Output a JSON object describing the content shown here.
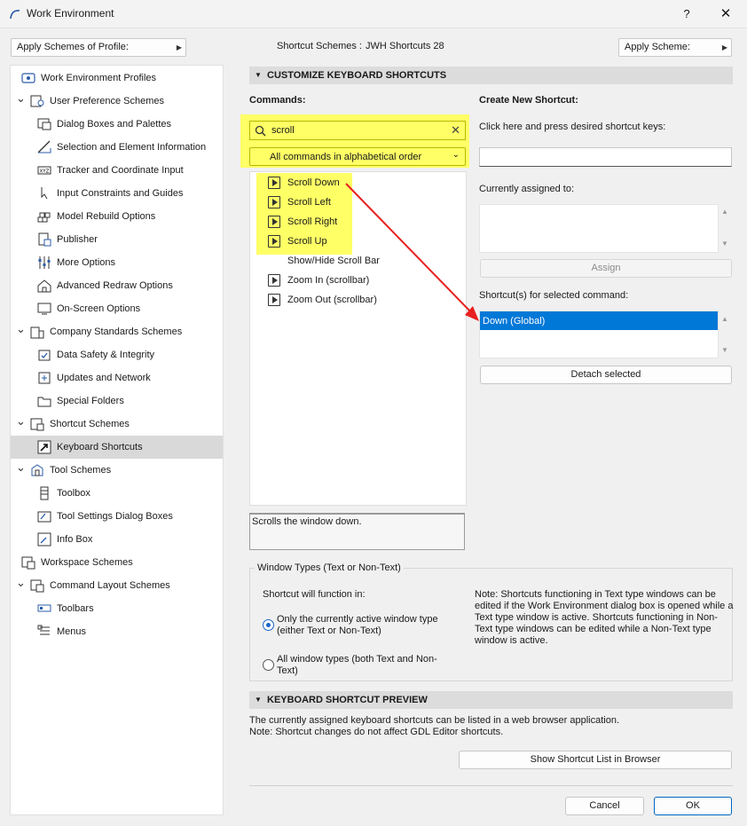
{
  "window": {
    "title": "Work Environment",
    "help": "?",
    "close": "✕"
  },
  "top_bar": {
    "apply_profile_label": "Apply Schemes of Profile:",
    "shortcut_schemes_label": "Shortcut Schemes :",
    "shortcut_schemes_value": "JWH Shortcuts 28",
    "apply_scheme_label": "Apply Scheme:"
  },
  "tree": {
    "items": [
      {
        "label": "Work Environment Profiles",
        "icon": "profiles-icon"
      },
      {
        "label": "User Preference Schemes",
        "icon": "user-prefs-icon",
        "expanded": true
      },
      {
        "label": "Dialog Boxes and Palettes",
        "icon": "dialog-icon"
      },
      {
        "label": "Selection and Element Information",
        "icon": "selection-icon"
      },
      {
        "label": "Tracker and Coordinate Input",
        "icon": "tracker-icon",
        "icon_text": "XYZ"
      },
      {
        "label": "Input Constraints and Guides",
        "icon": "cursor-icon"
      },
      {
        "label": "Model Rebuild Options",
        "icon": "model-rebuild-icon"
      },
      {
        "label": "Publisher",
        "icon": "publisher-icon"
      },
      {
        "label": "More Options",
        "icon": "sliders-icon"
      },
      {
        "label": "Advanced Redraw Options",
        "icon": "house-icon"
      },
      {
        "label": "On-Screen Options",
        "icon": "screen-icon"
      },
      {
        "label": "Company Standards Schemes",
        "icon": "company-icon",
        "expanded": true
      },
      {
        "label": "Data Safety & Integrity",
        "icon": "data-safety-icon"
      },
      {
        "label": "Updates and Network",
        "icon": "network-icon"
      },
      {
        "label": "Special Folders",
        "icon": "folder-icon"
      },
      {
        "label": "Shortcut Schemes",
        "icon": "shortcut-schemes-icon",
        "expanded": true
      },
      {
        "label": "Keyboard Shortcuts",
        "icon": "keyboard-shortcut-icon",
        "selected": true
      },
      {
        "label": "Tool Schemes",
        "icon": "tool-schemes-icon",
        "expanded": true
      },
      {
        "label": "Toolbox",
        "icon": "toolbox-icon"
      },
      {
        "label": "Tool Settings Dialog Boxes",
        "icon": "tool-settings-icon"
      },
      {
        "label": "Info Box",
        "icon": "info-box-icon"
      },
      {
        "label": "Workspace Schemes",
        "icon": "workspace-icon"
      },
      {
        "label": "Command Layout Schemes",
        "icon": "command-layout-icon",
        "expanded": true
      },
      {
        "label": "Toolbars",
        "icon": "toolbars-icon"
      },
      {
        "label": "Menus",
        "icon": "menus-icon"
      }
    ]
  },
  "customize": {
    "header": "CUSTOMIZE KEYBOARD SHORTCUTS",
    "commands_label": "Commands:",
    "search_value": "scroll",
    "filter_value": "All commands in alphabetical order",
    "commands": [
      {
        "label": "Scroll Down",
        "icon": true,
        "highlighted": true,
        "selected": true
      },
      {
        "label": "Scroll Left",
        "icon": true,
        "highlighted": true
      },
      {
        "label": "Scroll Right",
        "icon": true,
        "highlighted": true
      },
      {
        "label": "Scroll Up",
        "icon": true,
        "highlighted": true
      },
      {
        "label": "Show/Hide Scroll Bar",
        "icon": false
      },
      {
        "label": "Zoom In (scrollbar)",
        "icon": true
      },
      {
        "label": "Zoom Out (scrollbar)",
        "icon": true
      }
    ],
    "description": "Scrolls the window down.",
    "create_new_label": "Create New Shortcut:",
    "press_keys_label": "Click here and press desired shortcut keys:",
    "shortcut_input_value": "",
    "currently_assigned_label": "Currently assigned to:",
    "assign_label": "Assign",
    "shortcuts_for_selected_label": "Shortcut(s) for selected command:",
    "shortcuts": [
      "Down (Global)"
    ],
    "detach_label": "Detach selected"
  },
  "window_types": {
    "group_label": "Window Types (Text or Non-Text)",
    "function_in_label": "Shortcut will function in:",
    "option_active": "Only the currently active window type (either Text or Non-Text)",
    "option_all": "All window types (both Text and Non-Text)",
    "selected": "active",
    "note": "Note: Shortcuts functioning in Text type windows can be edited if the Work Environment dialog box is opened while a Text type window is active. Shortcuts functioning in Non-Text type windows can be edited while a Non-Text type window is active."
  },
  "preview": {
    "header": "KEYBOARD SHORTCUT PREVIEW",
    "line1": "The currently assigned keyboard shortcuts can be listed in a web browser application.",
    "line2": "Note: Shortcut changes do not affect GDL Editor shortcuts.",
    "show_list_label": "Show Shortcut List in Browser"
  },
  "footer": {
    "cancel_label": "Cancel",
    "ok_label": "OK"
  },
  "colors": {
    "highlight": "#ffff66",
    "selection": "#0078d7",
    "annotation_arrow": "#e8201f"
  }
}
